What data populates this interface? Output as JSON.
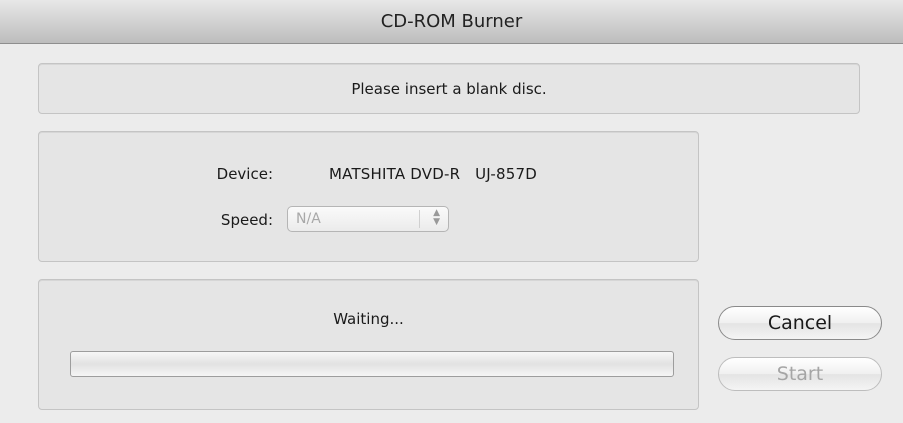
{
  "window": {
    "title": "CD-ROM Burner"
  },
  "message": "Please insert a blank disc.",
  "device": {
    "label": "Device:",
    "value": "MATSHITA DVD-R   UJ-857D"
  },
  "speed": {
    "label": "Speed:",
    "selected": "N/A",
    "arrows": "▲▼",
    "enabled": false
  },
  "progress": {
    "status": "Waiting...",
    "value": 0
  },
  "buttons": {
    "cancel_label": "Cancel",
    "start_label": "Start",
    "start_enabled": false
  }
}
